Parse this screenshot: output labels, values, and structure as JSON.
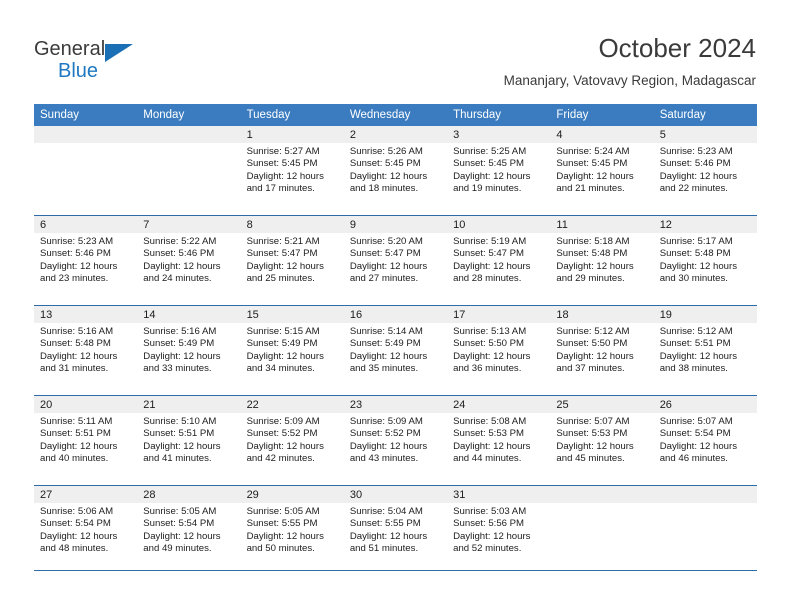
{
  "brand": {
    "name_top": "General",
    "name_bottom": "Blue",
    "triangle_icon": "triangle-icon",
    "color_dark": "#3b3b3b",
    "color_blue": "#1f78c1"
  },
  "header": {
    "title": "October 2024",
    "subtitle": "Mananjary, Vatovavy Region, Madagascar"
  },
  "theme": {
    "header_bg": "#3a7cbf",
    "rule_color": "#2d6ca8",
    "daynum_band_bg": "#efefef"
  },
  "weekdays": [
    "Sunday",
    "Monday",
    "Tuesday",
    "Wednesday",
    "Thursday",
    "Friday",
    "Saturday"
  ],
  "weeks": [
    [
      {
        "day": "",
        "lines": []
      },
      {
        "day": "",
        "lines": []
      },
      {
        "day": "1",
        "lines": [
          "Sunrise: 5:27 AM",
          "Sunset: 5:45 PM",
          "Daylight: 12 hours",
          "and 17 minutes."
        ]
      },
      {
        "day": "2",
        "lines": [
          "Sunrise: 5:26 AM",
          "Sunset: 5:45 PM",
          "Daylight: 12 hours",
          "and 18 minutes."
        ]
      },
      {
        "day": "3",
        "lines": [
          "Sunrise: 5:25 AM",
          "Sunset: 5:45 PM",
          "Daylight: 12 hours",
          "and 19 minutes."
        ]
      },
      {
        "day": "4",
        "lines": [
          "Sunrise: 5:24 AM",
          "Sunset: 5:45 PM",
          "Daylight: 12 hours",
          "and 21 minutes."
        ]
      },
      {
        "day": "5",
        "lines": [
          "Sunrise: 5:23 AM",
          "Sunset: 5:46 PM",
          "Daylight: 12 hours",
          "and 22 minutes."
        ]
      }
    ],
    [
      {
        "day": "6",
        "lines": [
          "Sunrise: 5:23 AM",
          "Sunset: 5:46 PM",
          "Daylight: 12 hours",
          "and 23 minutes."
        ]
      },
      {
        "day": "7",
        "lines": [
          "Sunrise: 5:22 AM",
          "Sunset: 5:46 PM",
          "Daylight: 12 hours",
          "and 24 minutes."
        ]
      },
      {
        "day": "8",
        "lines": [
          "Sunrise: 5:21 AM",
          "Sunset: 5:47 PM",
          "Daylight: 12 hours",
          "and 25 minutes."
        ]
      },
      {
        "day": "9",
        "lines": [
          "Sunrise: 5:20 AM",
          "Sunset: 5:47 PM",
          "Daylight: 12 hours",
          "and 27 minutes."
        ]
      },
      {
        "day": "10",
        "lines": [
          "Sunrise: 5:19 AM",
          "Sunset: 5:47 PM",
          "Daylight: 12 hours",
          "and 28 minutes."
        ]
      },
      {
        "day": "11",
        "lines": [
          "Sunrise: 5:18 AM",
          "Sunset: 5:48 PM",
          "Daylight: 12 hours",
          "and 29 minutes."
        ]
      },
      {
        "day": "12",
        "lines": [
          "Sunrise: 5:17 AM",
          "Sunset: 5:48 PM",
          "Daylight: 12 hours",
          "and 30 minutes."
        ]
      }
    ],
    [
      {
        "day": "13",
        "lines": [
          "Sunrise: 5:16 AM",
          "Sunset: 5:48 PM",
          "Daylight: 12 hours",
          "and 31 minutes."
        ]
      },
      {
        "day": "14",
        "lines": [
          "Sunrise: 5:16 AM",
          "Sunset: 5:49 PM",
          "Daylight: 12 hours",
          "and 33 minutes."
        ]
      },
      {
        "day": "15",
        "lines": [
          "Sunrise: 5:15 AM",
          "Sunset: 5:49 PM",
          "Daylight: 12 hours",
          "and 34 minutes."
        ]
      },
      {
        "day": "16",
        "lines": [
          "Sunrise: 5:14 AM",
          "Sunset: 5:49 PM",
          "Daylight: 12 hours",
          "and 35 minutes."
        ]
      },
      {
        "day": "17",
        "lines": [
          "Sunrise: 5:13 AM",
          "Sunset: 5:50 PM",
          "Daylight: 12 hours",
          "and 36 minutes."
        ]
      },
      {
        "day": "18",
        "lines": [
          "Sunrise: 5:12 AM",
          "Sunset: 5:50 PM",
          "Daylight: 12 hours",
          "and 37 minutes."
        ]
      },
      {
        "day": "19",
        "lines": [
          "Sunrise: 5:12 AM",
          "Sunset: 5:51 PM",
          "Daylight: 12 hours",
          "and 38 minutes."
        ]
      }
    ],
    [
      {
        "day": "20",
        "lines": [
          "Sunrise: 5:11 AM",
          "Sunset: 5:51 PM",
          "Daylight: 12 hours",
          "and 40 minutes."
        ]
      },
      {
        "day": "21",
        "lines": [
          "Sunrise: 5:10 AM",
          "Sunset: 5:51 PM",
          "Daylight: 12 hours",
          "and 41 minutes."
        ]
      },
      {
        "day": "22",
        "lines": [
          "Sunrise: 5:09 AM",
          "Sunset: 5:52 PM",
          "Daylight: 12 hours",
          "and 42 minutes."
        ]
      },
      {
        "day": "23",
        "lines": [
          "Sunrise: 5:09 AM",
          "Sunset: 5:52 PM",
          "Daylight: 12 hours",
          "and 43 minutes."
        ]
      },
      {
        "day": "24",
        "lines": [
          "Sunrise: 5:08 AM",
          "Sunset: 5:53 PM",
          "Daylight: 12 hours",
          "and 44 minutes."
        ]
      },
      {
        "day": "25",
        "lines": [
          "Sunrise: 5:07 AM",
          "Sunset: 5:53 PM",
          "Daylight: 12 hours",
          "and 45 minutes."
        ]
      },
      {
        "day": "26",
        "lines": [
          "Sunrise: 5:07 AM",
          "Sunset: 5:54 PM",
          "Daylight: 12 hours",
          "and 46 minutes."
        ]
      }
    ],
    [
      {
        "day": "27",
        "lines": [
          "Sunrise: 5:06 AM",
          "Sunset: 5:54 PM",
          "Daylight: 12 hours",
          "and 48 minutes."
        ]
      },
      {
        "day": "28",
        "lines": [
          "Sunrise: 5:05 AM",
          "Sunset: 5:54 PM",
          "Daylight: 12 hours",
          "and 49 minutes."
        ]
      },
      {
        "day": "29",
        "lines": [
          "Sunrise: 5:05 AM",
          "Sunset: 5:55 PM",
          "Daylight: 12 hours",
          "and 50 minutes."
        ]
      },
      {
        "day": "30",
        "lines": [
          "Sunrise: 5:04 AM",
          "Sunset: 5:55 PM",
          "Daylight: 12 hours",
          "and 51 minutes."
        ]
      },
      {
        "day": "31",
        "lines": [
          "Sunrise: 5:03 AM",
          "Sunset: 5:56 PM",
          "Daylight: 12 hours",
          "and 52 minutes."
        ]
      },
      {
        "day": "",
        "lines": []
      },
      {
        "day": "",
        "lines": []
      }
    ]
  ]
}
